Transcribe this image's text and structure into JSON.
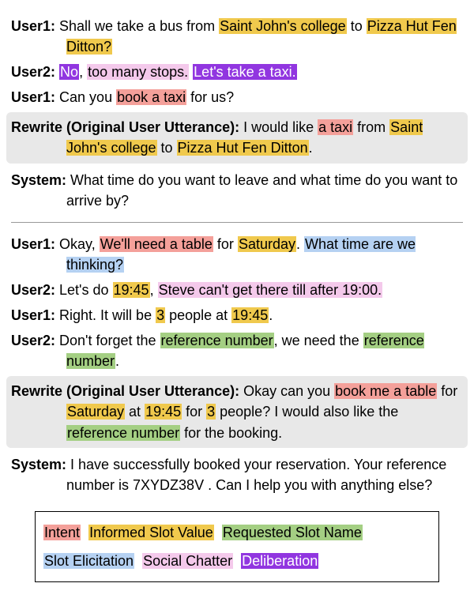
{
  "d1": {
    "u1": {
      "sp": "User1:",
      "t1": " Shall we take a bus from ",
      "h1": "Saint John's college",
      "t2": " to ",
      "h2": "Pizza Hut Fen Ditton?"
    },
    "u2": {
      "sp": "User2:",
      "h1": "No",
      "t1": ", ",
      "h2": "too many stops.",
      "t2": " ",
      "h3": "Let's take a taxi."
    },
    "u3": {
      "sp": "User1:",
      "t1": " Can you ",
      "h1": "book a taxi",
      "t2": " for us?"
    },
    "rw": {
      "sp": "Rewrite (Original User Utterance):",
      "t1": " I would like ",
      "h1": "a taxi",
      "t2": " from ",
      "h2": "Saint John's college",
      "t3": " to ",
      "h3": "Pizza Hut Fen Ditton",
      "t4": "."
    },
    "sys": {
      "sp": "System:",
      "t1": " What time do you want to leave and what time do you want to arrive by?"
    }
  },
  "d2": {
    "u1": {
      "sp": "User1:",
      "t1": " Okay, ",
      "h1": "We'll need a table",
      "t2": " for ",
      "h2": "Saturday",
      "t3": ". ",
      "h3": "What time are we thinking?"
    },
    "u2": {
      "sp": "User2:",
      "t1": " Let's do ",
      "h1": "19:45",
      "t2": ", ",
      "h2": "Steve can't get there till after 19:00."
    },
    "u3": {
      "sp": "User1:",
      "t1": " Right. It will be ",
      "h1": "3",
      "t2": " people at ",
      "h2": "19:45",
      "t3": "."
    },
    "u4": {
      "sp": "User2:",
      "t1": " Don't forget the ",
      "h1": "reference number",
      "t2": ", we need the ",
      "h2": "reference number",
      "t3": "."
    },
    "rw": {
      "sp": "Rewrite (Original User Utterance):",
      "t1": " Okay can you ",
      "h1": "book me a table",
      "t2": " for ",
      "h2": "Saturday",
      "t3": " at ",
      "h3": "19:45",
      "t4": " for ",
      "h4": "3",
      "t5": " people? I would also like the ",
      "h5": "reference number",
      "t6": " for the booking."
    },
    "sys": {
      "sp": "System:",
      "t1": " I have successfully booked your reservation. Your reference number is 7XYDZ38V . Can I help you with anything else?"
    }
  },
  "legend": {
    "intent": "Intent",
    "slot": "Informed Slot Value",
    "req": "Requested Slot Name",
    "elic": "Slot Elicitation",
    "chat": "Social Chatter",
    "delib": "Deliberation"
  }
}
